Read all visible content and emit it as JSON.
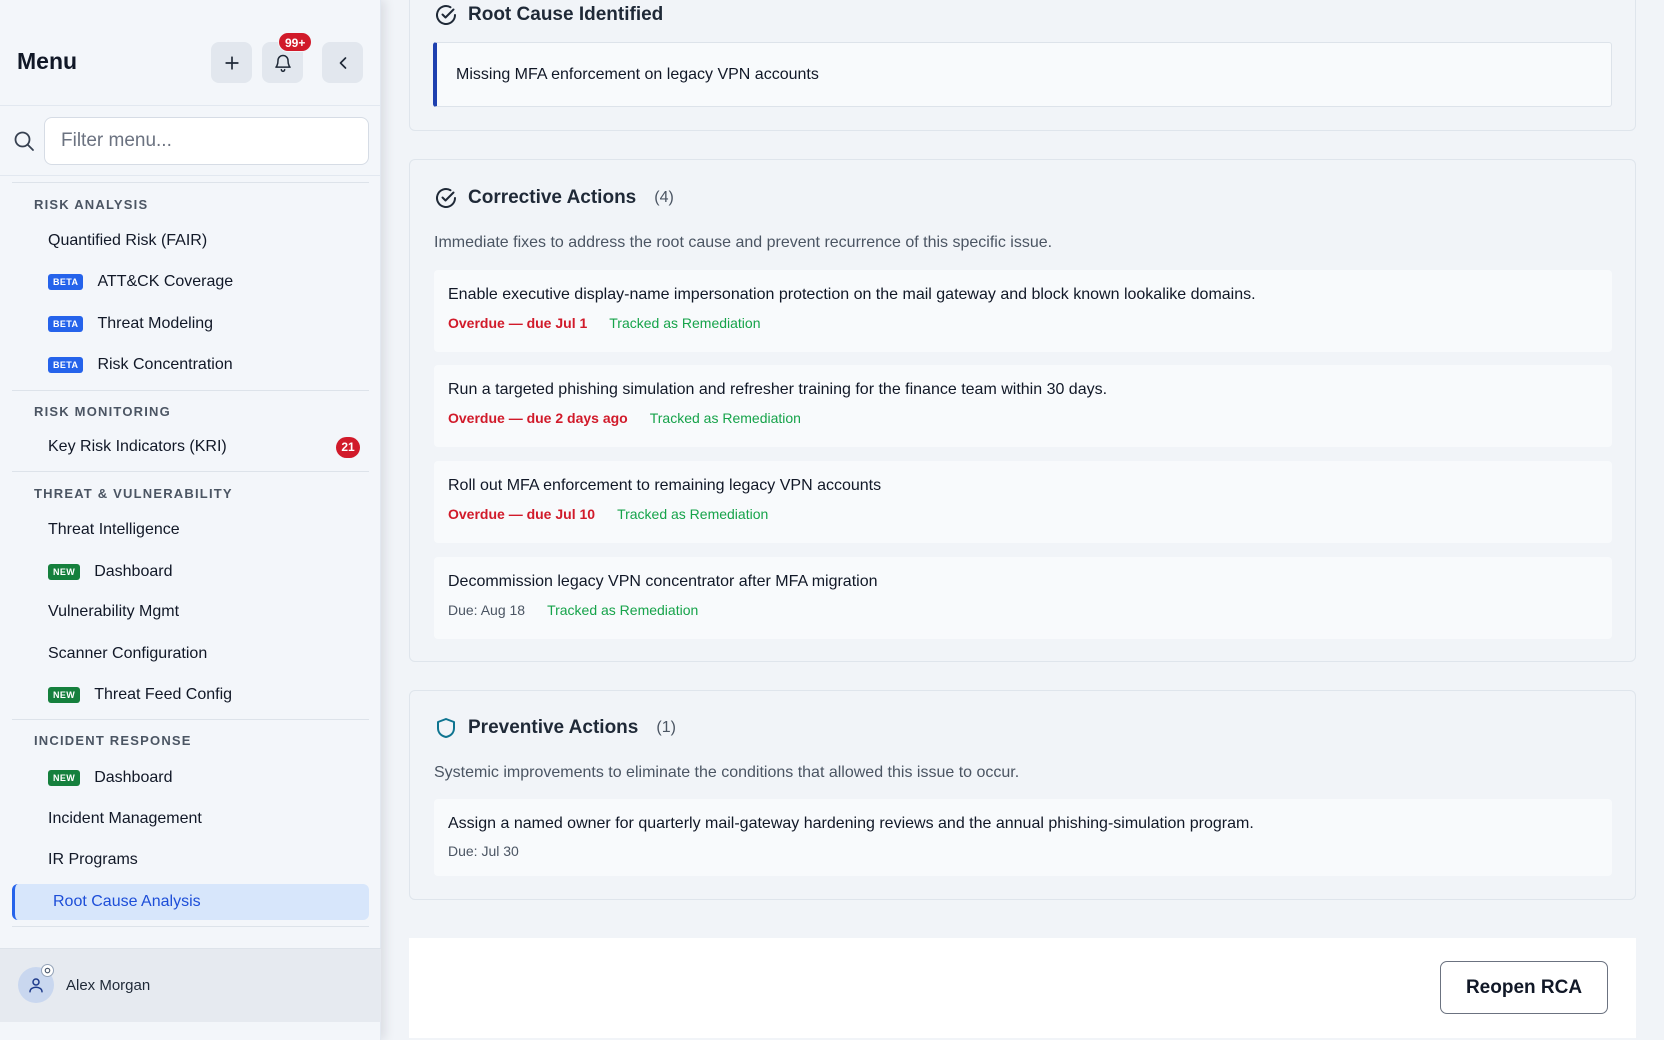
{
  "sidebar": {
    "title": "Menu",
    "notification_count": "99+",
    "search_placeholder": "Filter menu...",
    "sections": [
      {
        "label": "RISK ANALYSIS",
        "items": [
          {
            "label": "Quantified Risk (FAIR)",
            "tag": ""
          },
          {
            "label": "ATT&CK Coverage",
            "tag": "BETA"
          },
          {
            "label": "Threat Modeling",
            "tag": "BETA"
          },
          {
            "label": "Risk Concentration",
            "tag": "BETA"
          }
        ]
      },
      {
        "label": "RISK MONITORING",
        "items": [
          {
            "label": "Key Risk Indicators (KRI)",
            "tag": "",
            "badge": "21"
          }
        ]
      },
      {
        "label": "THREAT & VULNERABILITY",
        "items": [
          {
            "label": "Threat Intelligence",
            "tag": ""
          },
          {
            "label": "Dashboard",
            "tag": "NEW"
          },
          {
            "label": "Vulnerability Mgmt",
            "tag": ""
          },
          {
            "label": "Scanner Configuration",
            "tag": ""
          },
          {
            "label": "Threat Feed Config",
            "tag": "NEW"
          }
        ]
      },
      {
        "label": "INCIDENT RESPONSE",
        "items": [
          {
            "label": "Dashboard",
            "tag": "NEW"
          },
          {
            "label": "Incident Management",
            "tag": ""
          },
          {
            "label": "IR Programs",
            "tag": ""
          },
          {
            "label": "Root Cause Analysis",
            "tag": "",
            "active": true
          }
        ]
      }
    ],
    "user_name": "Alex Morgan"
  },
  "root_cause": {
    "title": "Root Cause Identified",
    "text": "Missing MFA enforcement on legacy VPN accounts"
  },
  "corrective": {
    "title": "Corrective Actions",
    "count": "(4)",
    "description": "Immediate fixes to address the root cause and prevent recurrence of this specific issue.",
    "actions": [
      {
        "text": "Enable executive display-name impersonation protection on the mail gateway and block known lookalike domains.",
        "due": "Overdue — due Jul 1",
        "tracked": "Tracked as Remediation"
      },
      {
        "text": "Run a targeted phishing simulation and refresher training for the finance team within 30 days.",
        "due": "Overdue — due 2 days ago",
        "tracked": "Tracked as Remediation"
      },
      {
        "text": "Roll out MFA enforcement to remaining legacy VPN accounts",
        "due": "Overdue — due Jul 10",
        "tracked": "Tracked as Remediation"
      },
      {
        "text": "Decommission legacy VPN concentrator after MFA migration",
        "due": "Due: Aug 18",
        "tracked": "Tracked as Remediation"
      }
    ]
  },
  "preventive": {
    "title": "Preventive Actions",
    "count": "(1)",
    "description": "Systemic improvements to eliminate the conditions that allowed this issue to occur.",
    "actions": [
      {
        "text": "Assign a named owner for quarterly mail-gateway hardening reviews and the annual phishing-simulation program.",
        "due": "Due: Jul 30"
      }
    ]
  },
  "footer": {
    "reopen_label": "Reopen RCA"
  },
  "colors": {
    "accent": "#2563eb",
    "overdue": "#d11a2a",
    "tracked": "#16a34a"
  }
}
